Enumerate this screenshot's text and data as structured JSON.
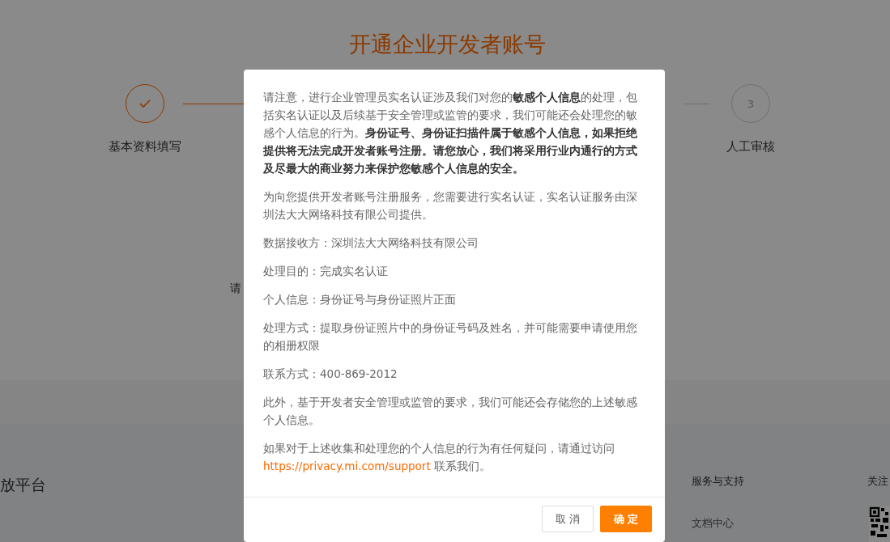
{
  "page": {
    "title": "开通企业开发者账号",
    "steps": [
      {
        "label": "基本资料填写",
        "done": true
      },
      {
        "label": "人工审核",
        "done": false,
        "number": "3"
      }
    ],
    "form_fragment": "请"
  },
  "footer": {
    "brand": "放平台",
    "columns": [
      {
        "heading": "服务与支持",
        "links": [
          "文档中心"
        ]
      },
      {
        "heading": "关注"
      }
    ]
  },
  "dialog": {
    "paragraphs": [
      {
        "kind": "text",
        "text": "请注意，进行企业管理员实名认证涉及我们对您的**敏感个人信息**的处理，包括实名认证以及后续基于安全管理或监管的要求，我们可能还会处理您的敏感个人信息的行为。**身份证号、身份证扫描件属于敏感个人信息，如果拒绝提供将无法完成开发者账号注册。请您放心，我们将采用行业内通行的方式及尽最大的商业努力来保护您敏感个人信息的安全。**"
      },
      {
        "kind": "text",
        "text": "为向您提供开发者账号注册服务，您需要进行实名认证，实名认证服务由深圳法大大网络科技有限公司提供。"
      },
      {
        "kind": "text",
        "text": "数据接收方：深圳法大大网络科技有限公司"
      },
      {
        "kind": "text",
        "text": "处理目的：完成实名认证"
      },
      {
        "kind": "text",
        "text": "个人信息：身份证号与身份证照片正面"
      },
      {
        "kind": "text",
        "text": "处理方式：提取身份证照片中的身份证号码及姓名，并可能需要申请使用您的相册权限"
      },
      {
        "kind": "text",
        "text": "联系方式：400-869-2012"
      },
      {
        "kind": "text",
        "text": "此外，基于开发者安全管理或监管的要求，我们可能还会存储您的上述敏感个人信息。"
      },
      {
        "kind": "link",
        "text": "如果对于上述收集和处理您的个人信息的行为有任何疑问，请通过访问",
        "link": "https://privacy.mi.com/support",
        "after": " 联系我们。"
      }
    ],
    "buttons": [
      {
        "label": "取 消",
        "kind": "secondary"
      },
      {
        "label": "确 定",
        "kind": "primary"
      }
    ]
  }
}
